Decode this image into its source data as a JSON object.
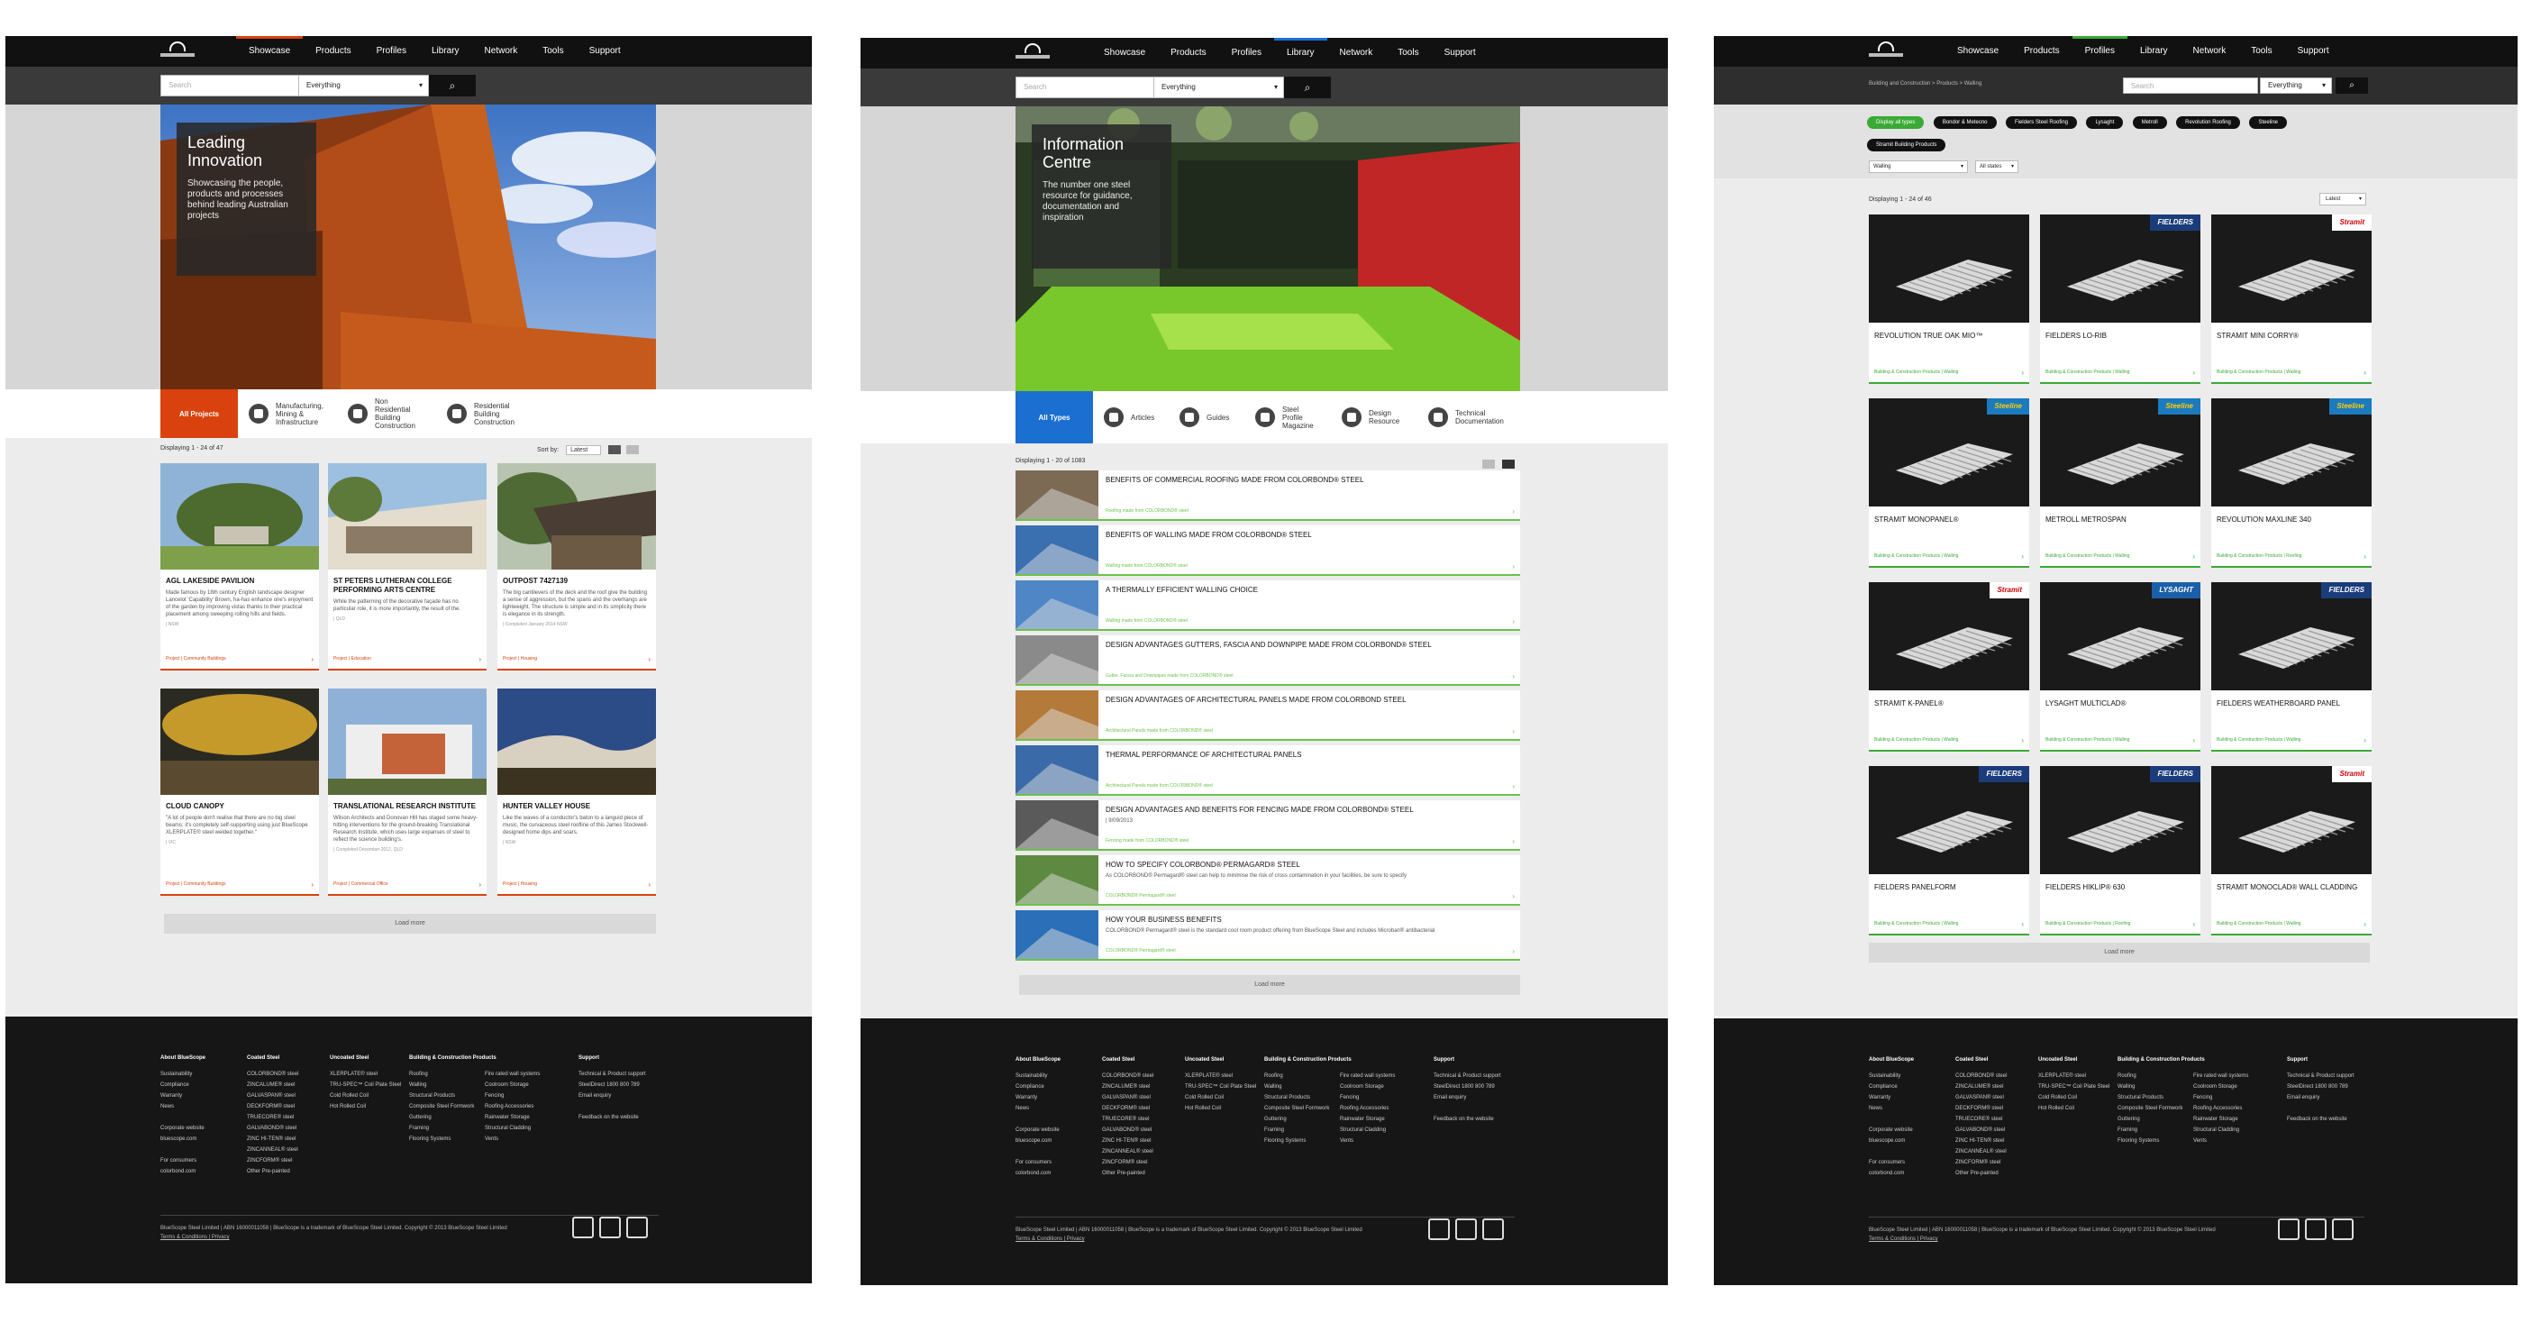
{
  "nav": {
    "items": [
      "Showcase",
      "Products",
      "Profiles",
      "Library",
      "Network",
      "Tools",
      "Support"
    ]
  },
  "search": {
    "placeholder": "Search",
    "scope": "Everything"
  },
  "p1": {
    "hero": {
      "title": "Leading Innovation",
      "body": "Showcasing the people, products and processes behind leading Australian projects"
    },
    "tabs": [
      "All Projects",
      "Manufacturing, Mining & Infrastructure",
      "Non Residential Building Construction",
      "Residential Building Construction"
    ],
    "displaying": "Displaying 1 - 24 of 47",
    "sort_label": "Sort by:",
    "sort_value": "Latest",
    "cards": [
      {
        "title": "AGL LAKESIDE PAVILION",
        "desc": "Made famous by 18th century English landscape designer Lancelot 'Capability' Brown, ha-has enhance one's enjoyment of the garden by improving vistas thanks to their practical placement among sweeping rolling hills and fields.",
        "meta": "| NSW",
        "tag": "Project | Community Buildings"
      },
      {
        "title": "ST PETERS LUTHERAN COLLEGE PERFORMING ARTS CENTRE",
        "desc": "While the patterning of the decorative façade has no particular role, it is more importantly, the result of the.",
        "meta": "| QLD",
        "tag": "Project | Education"
      },
      {
        "title": "OUTPOST 7427139",
        "desc": "The big cantilevers of the deck and the roof give the building a sense of aggression, but the spans and the overhangs are lightweight. The structure is simple and in its simplicity there is elegance in its strength.",
        "meta": "| Completed January 2014 NSW",
        "tag": "Project | Housing"
      },
      {
        "title": "CLOUD CANOPY",
        "desc": "\"A lot of people don't realise that there are no big steel beams; it's completely self-supporting using just BlueScope XLERPLATE® steel welded together.\"",
        "meta": "| VIC",
        "tag": "Project | Community Buildings"
      },
      {
        "title": "TRANSLATIONAL RESEARCH INSTITUTE",
        "desc": "Wilson Architects and Donovan Hill has staged some heavy-hitting interventions for the ground-breaking Translational Research Institute, which uses large expanses of steel to reflect the science building's.",
        "meta": "| Completed December 2012, QLD",
        "tag": "Project | Commercial Office"
      },
      {
        "title": "HUNTER VALLEY HOUSE",
        "desc": "Like the waves of a conductor's baton to a languid piece of music, the curvaceous steel roofline of this James Stockwell-designed home dips and soars.",
        "meta": "| NSW",
        "tag": "Project | Housing"
      }
    ],
    "load_more": "Load more"
  },
  "p2": {
    "hero": {
      "title": "Information Centre",
      "body": "The number one steel resource for guidance, documentation and inspiration"
    },
    "tabs": [
      "All Types",
      "Articles",
      "Guides",
      "Steel Profile Magazine",
      "Design Resource",
      "Technical Documentation"
    ],
    "displaying": "Displaying 1 - 20 of 1083",
    "rows": [
      {
        "title": "BENEFITS OF COMMERCIAL ROOFING MADE FROM COLORBOND® STEEL",
        "sub": "",
        "tag": "Roofing made from COLORBOND® steel"
      },
      {
        "title": "BENEFITS OF WALLING MADE FROM COLORBOND® STEEL",
        "sub": "",
        "tag": "Walling made from COLORBOND® steel"
      },
      {
        "title": "A THERMALLY EFFICIENT WALLING CHOICE",
        "sub": "",
        "tag": "Walling made from COLORBOND® steel"
      },
      {
        "title": "DESIGN ADVANTAGES GUTTERS, FASCIA AND DOWNPIPE MADE FROM COLORBOND® STEEL",
        "sub": "",
        "tag": "Gutter, Fascia and Downpipes made from COLORBOND® steel"
      },
      {
        "title": "DESIGN ADVANTAGES OF ARCHITECTURAL PANELS MADE FROM COLORBOND STEEL",
        "sub": "",
        "tag": "Architectural Panels made from COLORBOND® steel"
      },
      {
        "title": "THERMAL PERFORMANCE OF ARCHITECTURAL PANELS",
        "sub": "",
        "tag": "Architectural Panels made from COLORBOND® steel"
      },
      {
        "title": "DESIGN ADVANTAGES AND BENEFITS FOR FENCING MADE FROM COLORBOND® STEEL",
        "sub": "| 9/09/2013",
        "tag": "Fencing made from COLORBOND® steel"
      },
      {
        "title": "HOW TO SPECIFY COLORBOND® PERMAGARD® STEEL",
        "sub": "As COLORBOND® Permagard® steel can help to minimise the risk of cross contamination in your facilities, be sure to specify",
        "tag": "COLORBOND® Permagard® steel"
      },
      {
        "title": "HOW YOUR BUSINESS BENEFITS",
        "sub": "COLORBOND® Permagard® steel is the standard cool room product offering from BlueScope Steel and includes Microban® antibacterial",
        "tag": "COLORBOND® Permagard® steel"
      }
    ],
    "load_more": "Load more"
  },
  "p3": {
    "breadcrumb": "Building and Construction > Products > Walling",
    "filters": [
      "Display all types",
      "Bondor & Metecno",
      "Fielders Steel Roofing",
      "Lysaght",
      "Metroll",
      "Revolution Roofing",
      "Steeline",
      "Stramit Building Products"
    ],
    "sel1": "Walling",
    "sel2": "All states",
    "displaying": "Displaying 1 - 24 of 46",
    "sort_value": "Latest",
    "cards": [
      {
        "title": "REVOLUTION TRUE OAK MIO™",
        "brand": "",
        "tag": "Building & Construction Products | Walling"
      },
      {
        "title": "FIELDERS LO-RIB",
        "brand": "FIELDERS",
        "tag": "Building & Construction Products | Walling"
      },
      {
        "title": "STRAMIT MINI CORRY®",
        "brand": "Stramit",
        "tag": "Building & Construction Products | Walling"
      },
      {
        "title": "STRAMIT MONOPANEL®",
        "brand": "Steeline",
        "tag": "Building & Construction Products | Walling"
      },
      {
        "title": "METROLL METROSPAN",
        "brand": "Steeline",
        "tag": "Building & Construction Products | Walling"
      },
      {
        "title": "REVOLUTION MAXLINE 340",
        "brand": "Steeline",
        "tag": "Building & Construction Products | Roofing"
      },
      {
        "title": "STRAMIT K-PANEL®",
        "brand": "Stramit",
        "tag": "Building & Construction Products | Walling"
      },
      {
        "title": "LYSAGHT MULTICLAD®",
        "brand": "LYSAGHT",
        "tag": "Building & Construction Products | Walling"
      },
      {
        "title": "FIELDERS WEATHERBOARD PANEL",
        "brand": "FIELDERS",
        "tag": "Building & Construction Products | Walling"
      },
      {
        "title": "FIELDERS PANELFORM",
        "brand": "FIELDERS",
        "tag": "Building & Construction Products | Walling"
      },
      {
        "title": "FIELDERS HIKLIP® 630",
        "brand": "FIELDERS",
        "tag": "Building & Construction Products | Roofing"
      },
      {
        "title": "STRAMIT MONOCLAD® WALL CLADDING",
        "brand": "Stramit",
        "tag": "Building & Construction Products | Walling"
      }
    ],
    "load_more": "Load more"
  },
  "footer": {
    "col1": {
      "head": "About BlueScope",
      "items": [
        "Sustainability",
        "Compliance",
        "Warranty",
        "News",
        "",
        "Corporate website",
        "bluescope.com",
        "",
        "For consumers",
        "colorbond.com"
      ]
    },
    "col2": {
      "head": "Coated Steel",
      "items": [
        "COLORBOND® steel",
        "ZINCALUME® steel",
        "GALVASPAN® steel",
        "DECKFORM® steel",
        "TRUECORE® steel",
        "GALVABOND® steel",
        "ZINC HI-TEN® steel",
        "ZINCANNEAL® steel",
        "ZINCFORM® steel",
        "Other Pre-painted"
      ]
    },
    "col3": {
      "head": "Uncoated Steel",
      "items": [
        "XLERPLATE® steel",
        "TRU-SPEC™ Coil Plate Steel",
        "Cold Rolled Coil",
        "Hot Rolled Coil"
      ]
    },
    "col4": {
      "head": "Building & Construction Products",
      "items": [
        "Roofing",
        "Walling",
        "Structural Products",
        "Composite Steel Formwork",
        "Guttering",
        "Framing",
        "Flooring Systems"
      ]
    },
    "col5": {
      "head": "",
      "items": [
        "Fire rated wall systems",
        "Coolroom Storage",
        "Fencing",
        "Roofing Accessories",
        "Rainwater Storage",
        "Structural Cladding",
        "Vents"
      ]
    },
    "col6": {
      "head": "Support",
      "items": [
        "Technical & Product support",
        "SteelDirect 1800 800 789",
        "Email enquiry",
        "",
        "Feedback on the website"
      ]
    },
    "legal": "BlueScope Steel Limited | ABN 16000011058 | BlueScope is a trademark of BlueScope Steel Limited. Copyright © 2013 BlueScope Steel Limited",
    "links": "Terms & Conditions | Privacy"
  },
  "colors": {
    "showcase": "#d9420e",
    "library": "#1b6fd1",
    "profiles": "#3aaa35"
  }
}
